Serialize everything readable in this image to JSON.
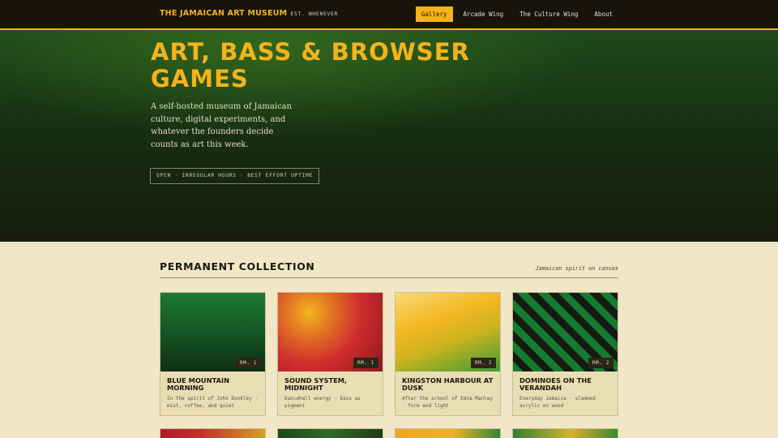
{
  "header": {
    "brand": "The Jamaican Art Museum",
    "tagline": "Est. Whenever",
    "nav": [
      {
        "label": "Gallery",
        "active": true
      },
      {
        "label": "Arcade Wing",
        "active": false
      },
      {
        "label": "The Culture Wing",
        "active": false
      },
      {
        "label": "About",
        "active": false
      }
    ]
  },
  "hero": {
    "title": "Art, Bass & Browser Games",
    "text": "A self-hosted museum of Jamaican culture, digital experiments, and whatever the founders decide counts as art this week.",
    "badge": "Open · Irregular hours · Best effort uptime"
  },
  "collection": {
    "title": "Permanent Collection",
    "subtitle": "Jamaican spirit on canvas",
    "cards": [
      {
        "room": "Rm. 1",
        "title": "Blue Mountain Morning",
        "desc": "In the spirit of John Dunkley · mist, coffee, and quiet"
      },
      {
        "room": "Rm. 1",
        "title": "Sound System, Midnight",
        "desc": "Dancehall energy · bass as pigment"
      },
      {
        "room": "Rm. 2",
        "title": "Kingston Harbour at Dusk",
        "desc": "After the school of Edna Manley · form and light"
      },
      {
        "room": "Rm. 2",
        "title": "Dominoes on the Verandah",
        "desc": "Everyday Jamaica · slammed acrylic on wood"
      }
    ]
  },
  "colors": {
    "accent_gold": "#f5b31a",
    "dark": "#17140c",
    "green": "#157a32",
    "cream": "#f1e6c6"
  }
}
